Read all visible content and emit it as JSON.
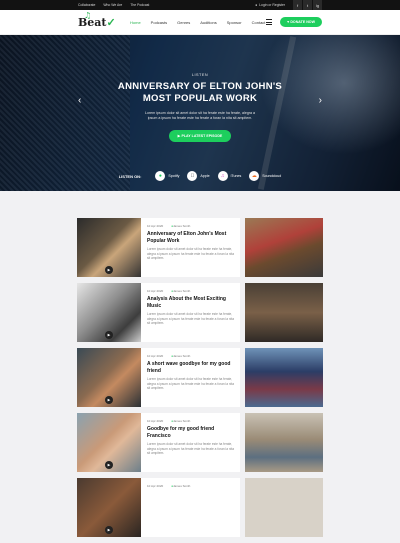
{
  "topbar": {
    "links": [
      "Collaborate",
      "Who We Are",
      "The Podcast"
    ],
    "login": "Login or Register",
    "social": [
      "f",
      "t",
      "ig"
    ]
  },
  "nav": {
    "logo": "Beat",
    "menu": [
      "Home",
      "Podcasts",
      "Genres",
      "Auditions",
      "Sponsor",
      "Contact"
    ],
    "active": "Home",
    "donate": "DONATE NOW"
  },
  "hero": {
    "kicker": "LISTEN",
    "title_line1": "ANNIVERSARY OF ELTON JOHN'S",
    "title_line2": "MOST POPULAR WORK",
    "text": "Lorem ipsum dolor sit amet dolor sit ha ferate este ha ferate, alegra a ipsum a ipsum ha ferate este ha ferate a foran la nita sit ampitem.",
    "cta": "PLAY LATEST EPISODE",
    "listen_label": "LISTEN ON:",
    "services": [
      {
        "name": "Spotify",
        "icon": "spotify-icon",
        "color": "#1dce5d"
      },
      {
        "name": "Apple",
        "icon": "apple-icon",
        "color": "#111111"
      },
      {
        "name": "iTunes",
        "icon": "itunes-icon",
        "color": "#d94fc4"
      },
      {
        "name": "Soundcloud",
        "icon": "soundcloud-icon",
        "color": "#f26f23"
      }
    ]
  },
  "articles": [
    {
      "date": "10 Apr 2020",
      "author": "James Smith",
      "title": "Anniversary of Elton John's Most Popular Work",
      "excerpt": "Lorem ipsum dolor sit amet dolor sit ha ferate este ha ferate, alegra a ipsum a ipsum ha ferate este ha ferate a foran la nita sit ampitem."
    },
    {
      "date": "10 Apr 2020",
      "author": "James Smith",
      "title": "Analysis About the Most Exciting Music",
      "excerpt": "Lorem ipsum dolor sit amet dolor sit ha ferate este ha ferate, alegra a ipsum a ipsum ha ferate este ha ferate a foran la nita sit ampitem."
    },
    {
      "date": "10 Apr 2020",
      "author": "James Smith",
      "title": "A short wave goodbye for my good friend",
      "excerpt": "Lorem ipsum dolor sit amet dolor sit ha ferate este ha ferate, alegra a ipsum a ipsum ha ferate este ha ferate a foran la nita sit ampitem."
    },
    {
      "date": "10 Apr 2020",
      "author": "James Smith",
      "title": "Goodbye for my good friend Francisco",
      "excerpt": "Lorem ipsum dolor sit amet dolor sit ha ferate este ha ferate, alegra a ipsum a ipsum ha ferate este ha ferate a foran la nita sit ampitem."
    },
    {
      "date": "10 Apr 2020",
      "author": "James Smith",
      "title": "",
      "excerpt": ""
    }
  ],
  "colors": {
    "accent": "#1dce5d",
    "dark": "#121212"
  }
}
